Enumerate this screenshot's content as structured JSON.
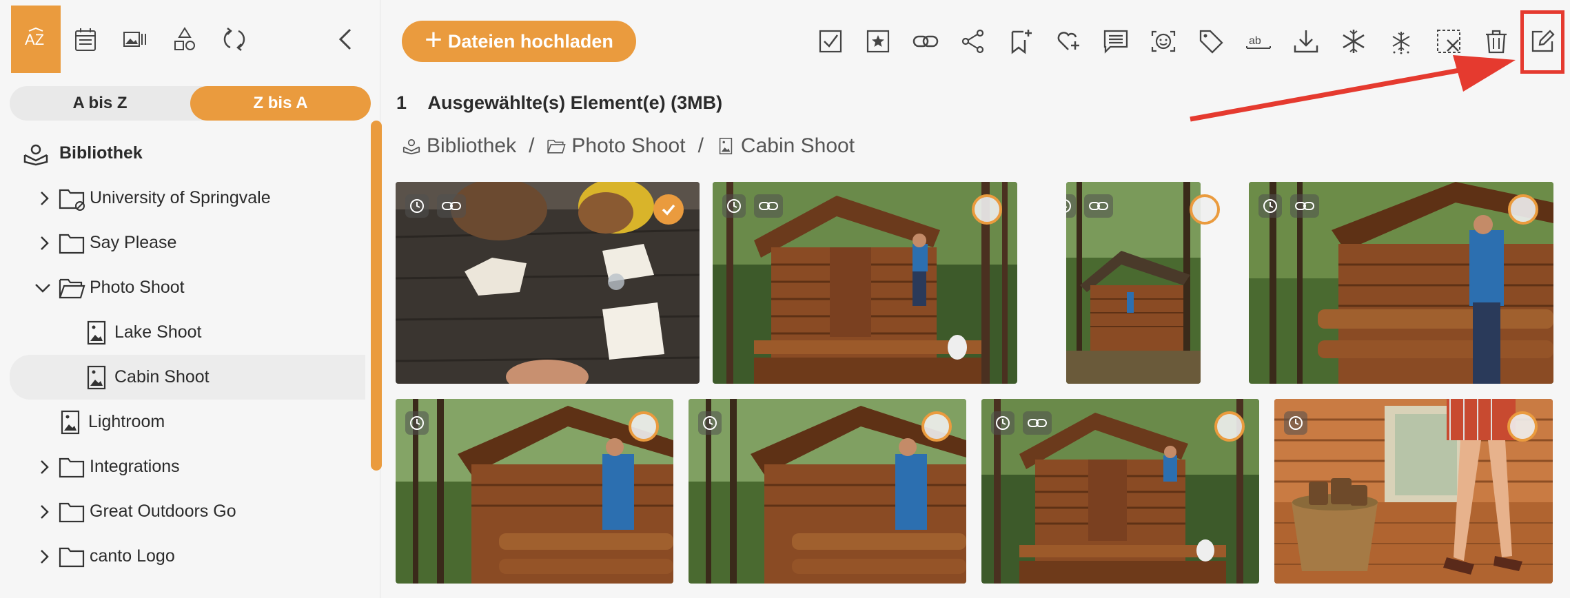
{
  "sidebar": {
    "tools": [
      {
        "icon": "sort-az-icon",
        "label": "AZ"
      },
      {
        "icon": "calendar-icon"
      },
      {
        "icon": "gallery-view-icon"
      },
      {
        "icon": "shapes-icon"
      },
      {
        "icon": "sync-icon"
      },
      {
        "icon": "collapse-chevron-left-icon"
      }
    ],
    "sort": {
      "asc": "A bis Z",
      "desc": "Z bis A",
      "active": "desc"
    },
    "tree": [
      {
        "label": "Bibliothek",
        "type": "library",
        "level": 0
      },
      {
        "label": "University of Springvale",
        "type": "folder-shared",
        "level": 1,
        "expandable": true
      },
      {
        "label": "Say Please",
        "type": "folder",
        "level": 1,
        "expandable": true
      },
      {
        "label": "Photo Shoot",
        "type": "folder-open",
        "level": 1,
        "expanded": true
      },
      {
        "label": "Lake Shoot",
        "type": "album",
        "level": 2
      },
      {
        "label": "Cabin Shoot",
        "type": "album",
        "level": 2,
        "selected": true
      },
      {
        "label": "Lightroom",
        "type": "album",
        "level": 1
      },
      {
        "label": "Integrations",
        "type": "folder",
        "level": 1,
        "expandable": true
      },
      {
        "label": "Great Outdoors Go",
        "type": "folder",
        "level": 1,
        "expandable": true
      },
      {
        "label": "canto Logo",
        "type": "folder",
        "level": 1,
        "expandable": true
      }
    ]
  },
  "toolbar": {
    "upload_label": "Dateien hochladen",
    "actions": [
      "select-all-icon",
      "favorite-star-icon",
      "link-icon",
      "share-icon",
      "bookmark-add-icon",
      "heart-add-icon",
      "comment-icon",
      "face-recognition-icon",
      "tag-icon",
      "rename-text-icon",
      "download-icon",
      "freeze-icon",
      "unfreeze-icon",
      "deselect-icon",
      "trash-icon",
      "edit-icon"
    ]
  },
  "selection": {
    "count": "1",
    "text": "Ausgewählte(s) Element(e) (3MB)"
  },
  "breadcrumb": [
    "Bibliothek",
    "Photo Shoot",
    "Cabin Shoot"
  ],
  "colors": {
    "accent": "#ea9b3e",
    "highlight": "#e53a2f"
  },
  "assets": [
    {
      "name": "table-study",
      "clock": true,
      "link": true,
      "selected": true
    },
    {
      "name": "cabin-man-dog",
      "clock": true,
      "link": true,
      "selected": false
    },
    {
      "name": "cabin-forest-portrait",
      "clock": true,
      "link": true,
      "selected": false
    },
    {
      "name": "cabin-man-railing",
      "clock": true,
      "link": true,
      "selected": false
    },
    {
      "name": "cabin-man-phone-1",
      "clock": true,
      "link": false,
      "selected": false
    },
    {
      "name": "cabin-man-phone-2",
      "clock": true,
      "link": false,
      "selected": false
    },
    {
      "name": "cabin-man-dog-2",
      "clock": true,
      "link": true,
      "selected": false
    },
    {
      "name": "firewood-basket",
      "clock": true,
      "link": false,
      "selected": false
    }
  ]
}
